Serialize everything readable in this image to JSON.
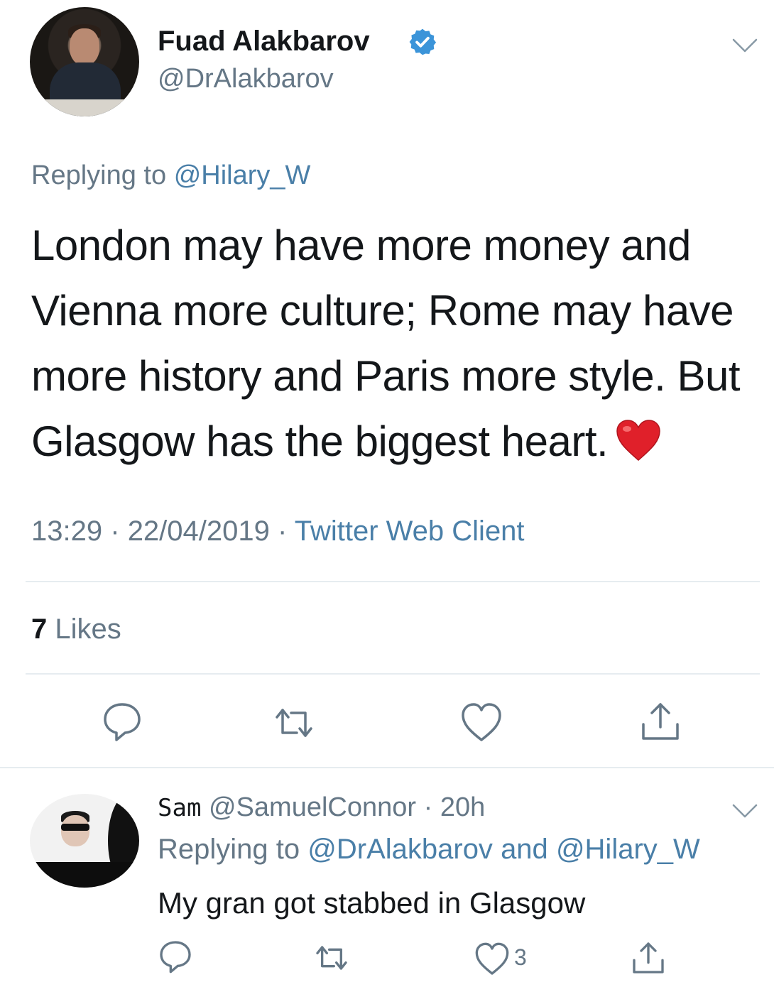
{
  "main_tweet": {
    "author_name": "Fuad Alakbarov",
    "author_handle": "@DrAlakbarov",
    "replying_prefix": "Replying to",
    "replying_to": "@Hilary_W",
    "text_lines": [
      "London may have more money and",
      "Vienna more culture; Rome may have",
      "more history and Paris more style. But",
      "Glasgow has the biggest heart."
    ],
    "time": "13:29",
    "date": "22/04/2019",
    "separator": "·",
    "client": "Twitter Web Client",
    "likes_count": "7",
    "likes_label": "Likes"
  },
  "reply_tweet": {
    "author_name": "Sam",
    "author_handle": "@SamuelConnor",
    "age": "20h",
    "replying_prefix": "Replying to",
    "replying_to_1": "@DrAlakbarov",
    "and_word": "and",
    "replying_to_2": "@Hilary_W",
    "text": "My gran got stabbed in Glasgow",
    "like_count": "3"
  },
  "icons": {
    "verified": "verified-badge-icon",
    "chevron": "chevron-down-icon",
    "reply": "reply-icon",
    "retweet": "retweet-icon",
    "like": "heart-outline-icon",
    "share": "share-icon",
    "emoji": "red-heart-emoji"
  },
  "colors": {
    "link": "#4a7fa8",
    "secondary_text": "#657786",
    "primary_text": "#14171a",
    "verified": "#3b94d9",
    "emoji_heart": "#e0202a"
  }
}
